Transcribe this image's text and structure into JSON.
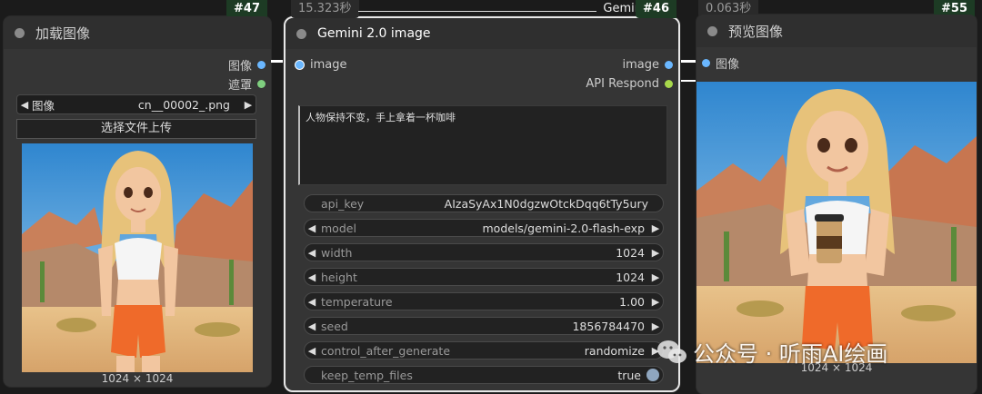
{
  "load_node": {
    "id": "#47",
    "title": "加载图像",
    "outputs": [
      "图像",
      "遮罩"
    ],
    "image_widget": {
      "label": "图像",
      "value": "cn__00002_.png"
    },
    "upload_button": "选择文件上传",
    "image_size": "1024 × 1024"
  },
  "gemini_node": {
    "id": "#46",
    "timer": "15.323秒",
    "header_label": "Gemin",
    "title": "Gemini 2.0 image",
    "input": "image",
    "outputs": [
      "image",
      "API Respond"
    ],
    "prompt": "人物保持不变，手上拿着一杯咖啡",
    "widgets": [
      {
        "label": "api_key",
        "value": "AIzaSyAx1N0dgzwOtckDqq6tTy5ury"
      },
      {
        "label": "model",
        "value": "models/gemini-2.0-flash-exp"
      },
      {
        "label": "width",
        "value": "1024"
      },
      {
        "label": "height",
        "value": "1024"
      },
      {
        "label": "temperature",
        "value": "1.00"
      },
      {
        "label": "seed",
        "value": "1856784470"
      },
      {
        "label": "control_after_generate",
        "value": "randomize"
      },
      {
        "label": "keep_temp_files",
        "value": "true"
      }
    ]
  },
  "preview_node": {
    "id": "#55",
    "timer": "0.063秒",
    "title": "预览图像",
    "input": "图像",
    "image_size": "1024 × 1024"
  },
  "watermark": "公众号 · 听雨AI绘画",
  "colors": {
    "node_bg": "#353535",
    "node_id_bg": "#1d3b24",
    "slot_image": "#6ab7ff",
    "slot_mask": "#7fcf7f",
    "slot_api": "#a7d84b"
  }
}
